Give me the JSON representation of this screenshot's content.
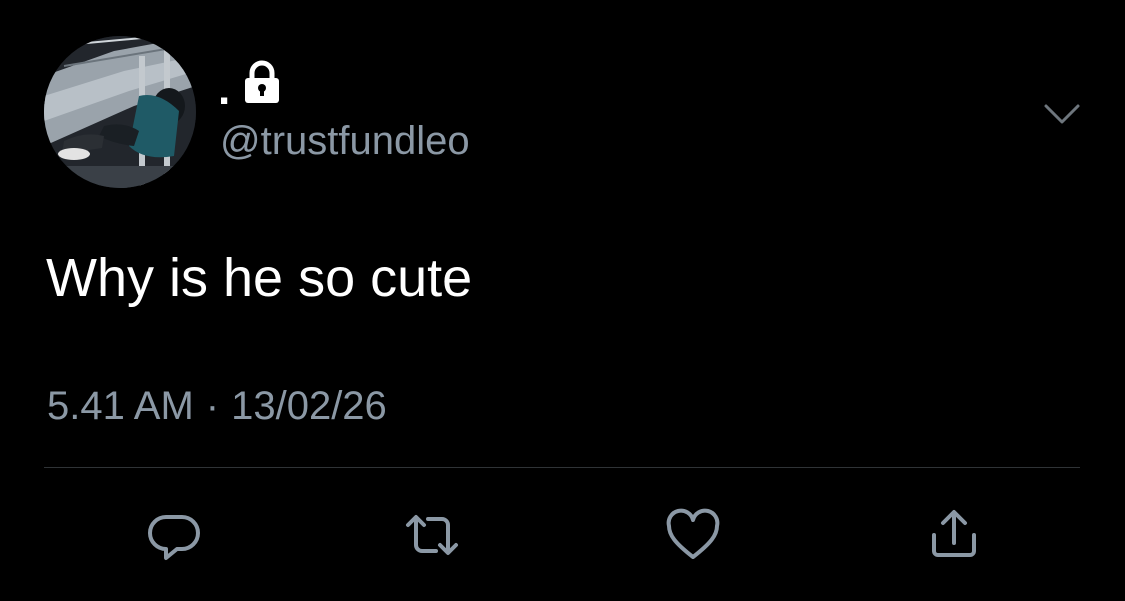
{
  "tweet": {
    "display_name": ".",
    "protected_icon": "lock-icon",
    "handle": "@trustfundleo",
    "text": "Why is he so cute",
    "time": "5.41 AM",
    "separator": "·",
    "date": "13/02/26"
  },
  "menu_icon": "chevron-down-icon",
  "actions": [
    {
      "icon": "reply-icon"
    },
    {
      "icon": "retweet-icon"
    },
    {
      "icon": "like-icon"
    },
    {
      "icon": "share-icon"
    }
  ],
  "colors": {
    "background": "#000000",
    "primary_text": "#ffffff",
    "secondary_text": "#8b98a5",
    "divider": "#2f3336"
  }
}
